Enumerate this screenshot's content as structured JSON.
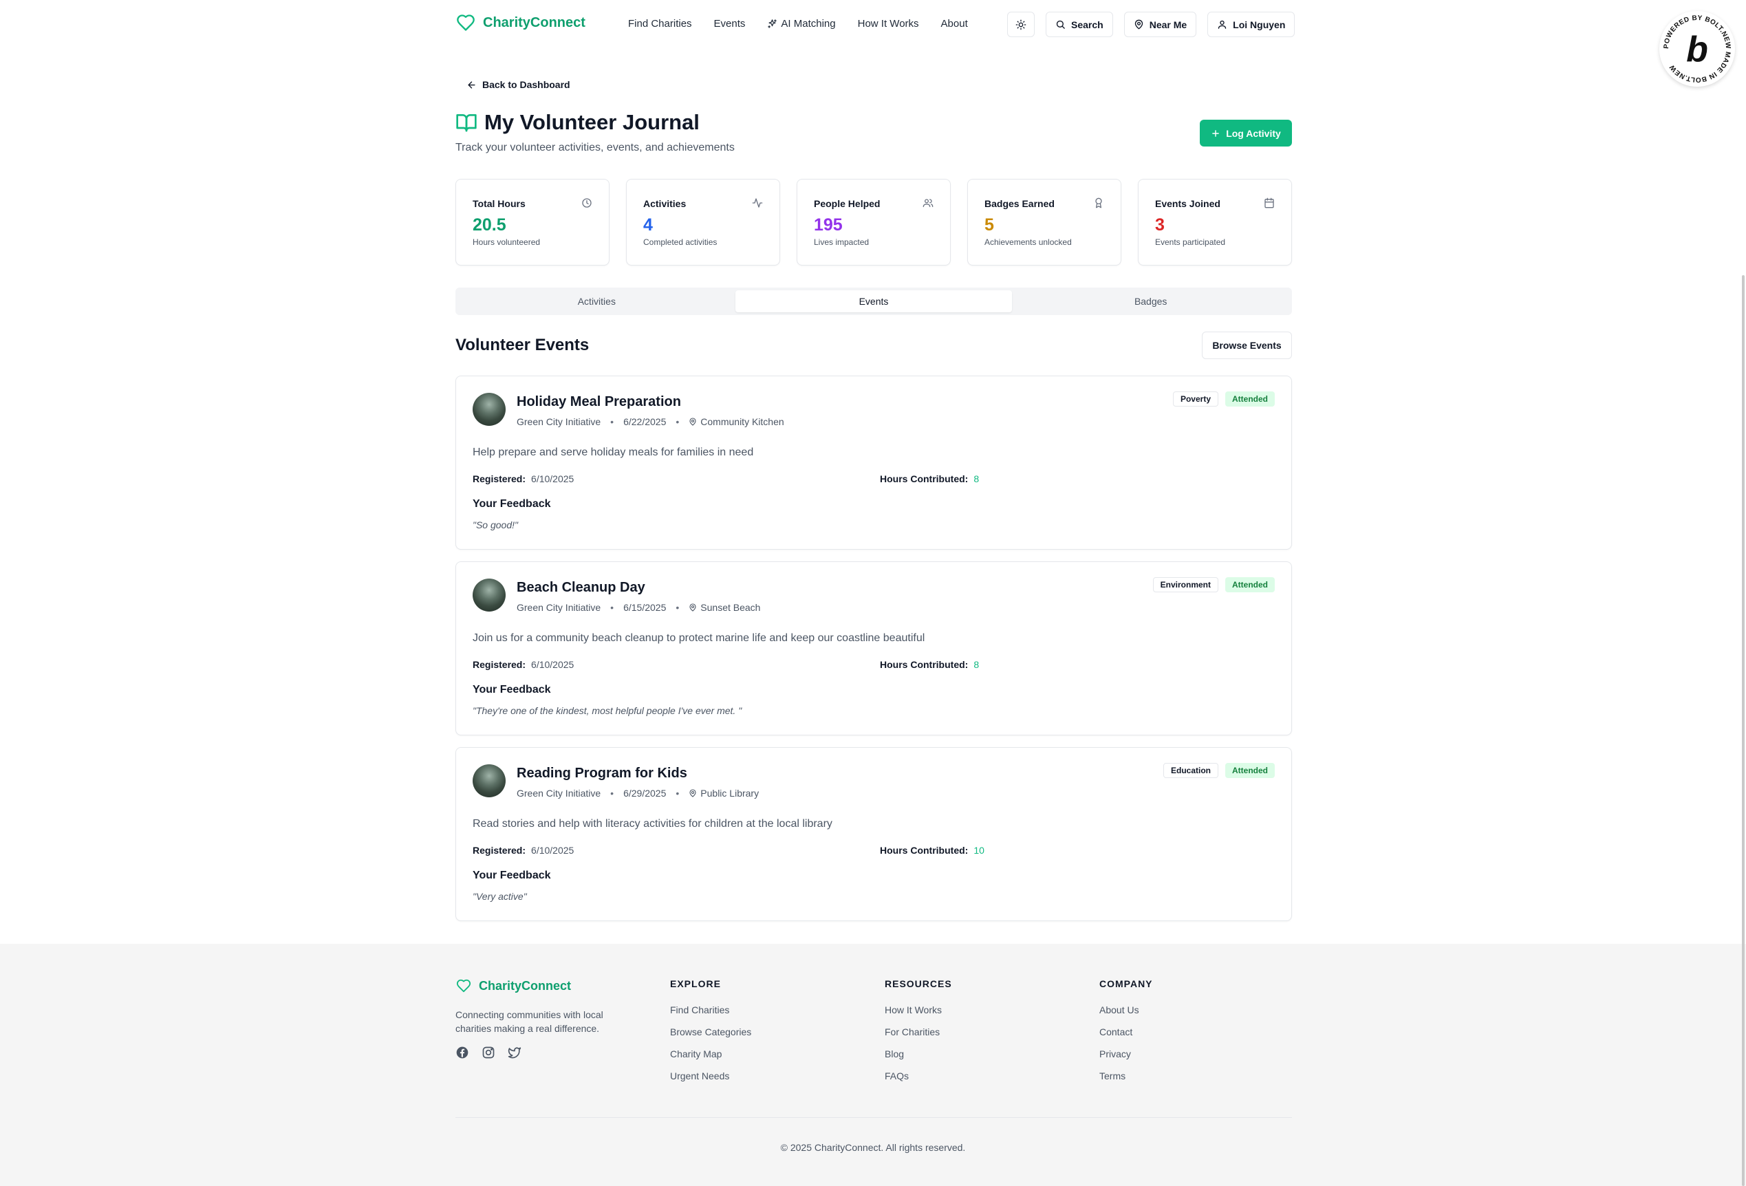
{
  "brand": {
    "name": "CharityConnect",
    "color": "#0e9f6e"
  },
  "nav": {
    "items": [
      {
        "label": "Find Charities"
      },
      {
        "label": "Events"
      },
      {
        "label": "AI Matching"
      },
      {
        "label": "How It Works"
      },
      {
        "label": "About"
      }
    ]
  },
  "header": {
    "search_label": "Search",
    "near_me_label": "Near Me",
    "user_name": "Loi Nguyen"
  },
  "page": {
    "back_label": "Back to Dashboard",
    "title": "My Volunteer Journal",
    "subtitle": "Track your volunteer activities, events, and achievements",
    "log_button": "Log Activity"
  },
  "stats": [
    {
      "label": "Total Hours",
      "value": "20.5",
      "desc": "Hours volunteered",
      "color": "#0e9f6e",
      "icon": "clock-icon"
    },
    {
      "label": "Activities",
      "value": "4",
      "desc": "Completed activities",
      "color": "#2563eb",
      "icon": "activity-icon"
    },
    {
      "label": "People Helped",
      "value": "195",
      "desc": "Lives impacted",
      "color": "#9333ea",
      "icon": "users-icon"
    },
    {
      "label": "Badges Earned",
      "value": "5",
      "desc": "Achievements unlocked",
      "color": "#ca8a04",
      "icon": "award-icon"
    },
    {
      "label": "Events Joined",
      "value": "3",
      "desc": "Events participated",
      "color": "#dc2626",
      "icon": "calendar-icon"
    }
  ],
  "tabs": [
    {
      "label": "Activities",
      "active": false
    },
    {
      "label": "Events",
      "active": true
    },
    {
      "label": "Badges",
      "active": false
    }
  ],
  "events_section": {
    "title": "Volunteer Events",
    "browse_label": "Browse Events",
    "registered_label": "Registered:",
    "hours_label": "Hours Contributed:",
    "feedback_label": "Your Feedback",
    "events": [
      {
        "title": "Holiday Meal Preparation",
        "org": "Green City Initiative",
        "date": "6/22/2025",
        "location": "Community Kitchen",
        "category": "Poverty",
        "status": "Attended",
        "description": "Help prepare and serve holiday meals for families in need",
        "registered": "6/10/2025",
        "hours": "8",
        "feedback": "\"So good!\""
      },
      {
        "title": "Beach Cleanup Day",
        "org": "Green City Initiative",
        "date": "6/15/2025",
        "location": "Sunset Beach",
        "category": "Environment",
        "status": "Attended",
        "description": "Join us for a community beach cleanup to protect marine life and keep our coastline beautiful",
        "registered": "6/10/2025",
        "hours": "8",
        "feedback": "\"They're one of the kindest, most helpful people I've ever met. \""
      },
      {
        "title": "Reading Program for Kids",
        "org": "Green City Initiative",
        "date": "6/29/2025",
        "location": "Public Library",
        "category": "Education",
        "status": "Attended",
        "description": "Read stories and help with literacy activities for children at the local library",
        "registered": "6/10/2025",
        "hours": "10",
        "feedback": "\"Very active\""
      }
    ]
  },
  "footer": {
    "brand": "CharityConnect",
    "description": "Connecting communities with local charities making a real difference.",
    "columns": [
      {
        "heading": "EXPLORE",
        "links": [
          "Find Charities",
          "Browse Categories",
          "Charity Map",
          "Urgent Needs"
        ]
      },
      {
        "heading": "RESOURCES",
        "links": [
          "How It Works",
          "For Charities",
          "Blog",
          "FAQs"
        ]
      },
      {
        "heading": "COMPANY",
        "links": [
          "About Us",
          "Contact",
          "Privacy",
          "Terms"
        ]
      }
    ],
    "copyright": "© 2025 CharityConnect. All rights reserved."
  },
  "bolt_badge": {
    "ring_text": "POWERED BY BOLT.NEW MADE IN BOLT.NEW",
    "letter": "b"
  }
}
